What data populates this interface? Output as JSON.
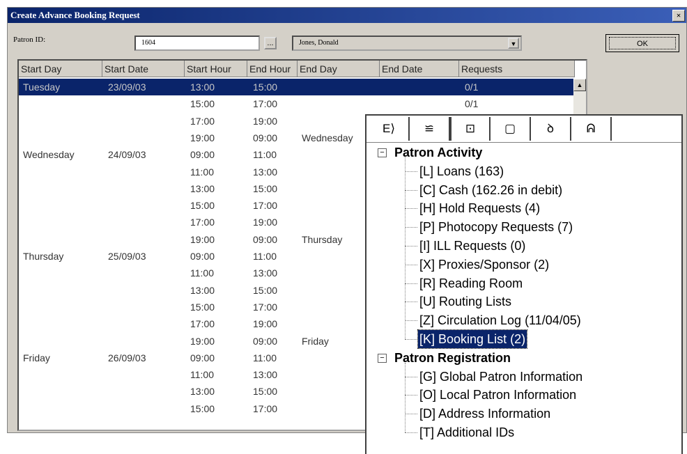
{
  "window": {
    "title": "Create Advance Booking Request",
    "close_label": "×"
  },
  "patron": {
    "id_label": "Patron ID:",
    "id_value": "1604",
    "lookup_label": "...",
    "name_value": "Jones, Donald",
    "dropdown_label": "▼"
  },
  "ok_label": "OK",
  "table": {
    "columns": [
      "Start Day",
      "Start Date",
      "Start Hour",
      "End Hour",
      "End Day",
      "End Date",
      "Requests"
    ],
    "rows": [
      [
        "Tuesday",
        "23/09/03",
        "13:00",
        "15:00",
        "",
        "",
        "0/1"
      ],
      [
        "",
        "",
        "15:00",
        "17:00",
        "",
        "",
        "0/1"
      ],
      [
        "",
        "",
        "17:00",
        "19:00",
        "",
        "",
        ""
      ],
      [
        "",
        "",
        "19:00",
        "09:00",
        "Wednesday",
        "",
        ""
      ],
      [
        "Wednesday",
        "24/09/03",
        "09:00",
        "11:00",
        "",
        "",
        ""
      ],
      [
        "",
        "",
        "11:00",
        "13:00",
        "",
        "",
        ""
      ],
      [
        "",
        "",
        "13:00",
        "15:00",
        "",
        "",
        ""
      ],
      [
        "",
        "",
        "15:00",
        "17:00",
        "",
        "",
        ""
      ],
      [
        "",
        "",
        "17:00",
        "19:00",
        "",
        "",
        ""
      ],
      [
        "",
        "",
        "19:00",
        "09:00",
        "Thursday",
        "",
        ""
      ],
      [
        "Thursday",
        "25/09/03",
        "09:00",
        "11:00",
        "",
        "",
        ""
      ],
      [
        "",
        "",
        "11:00",
        "13:00",
        "",
        "",
        ""
      ],
      [
        "",
        "",
        "13:00",
        "15:00",
        "",
        "",
        ""
      ],
      [
        "",
        "",
        "15:00",
        "17:00",
        "",
        "",
        ""
      ],
      [
        "",
        "",
        "17:00",
        "19:00",
        "",
        "",
        ""
      ],
      [
        "",
        "",
        "19:00",
        "09:00",
        "Friday",
        "",
        ""
      ],
      [
        "Friday",
        "26/09/03",
        "09:00",
        "11:00",
        "",
        "",
        ""
      ],
      [
        "",
        "",
        "11:00",
        "13:00",
        "",
        "",
        ""
      ],
      [
        "",
        "",
        "13:00",
        "15:00",
        "",
        "",
        ""
      ],
      [
        "",
        "",
        "15:00",
        "17:00",
        "",
        "",
        ""
      ]
    ],
    "selected_row": 0
  },
  "scroll_up_label": "▲",
  "panel": {
    "tabs": [
      {
        "icon": "exit-icon",
        "glyph": "E⟩"
      },
      {
        "icon": "patron-icon",
        "glyph": "≌"
      },
      {
        "icon": "activity-icon",
        "glyph": "⊡"
      },
      {
        "icon": "notebook-icon",
        "glyph": "▢"
      },
      {
        "icon": "hand-icon",
        "glyph": "ꝺ"
      },
      {
        "icon": "binoculars-icon",
        "glyph": "ᕱ"
      }
    ],
    "active_tab": 2,
    "groups": [
      {
        "label": "Patron Activity",
        "expander": "−",
        "items": [
          "[L] Loans (163)",
          "[C] Cash (162.26 in debit)",
          "[H] Hold Requests (4)",
          "[P] Photocopy Requests (7)",
          "[I] ILL Requests (0)",
          "[X] Proxies/Sponsor (2)",
          "[R] Reading Room",
          "[U] Routing Lists",
          "[Z] Circulation Log (11/04/05)",
          "[K] Booking List (2)"
        ],
        "selected_item": 9
      },
      {
        "label": "Patron Registration",
        "expander": "−",
        "items": [
          "[G] Global Patron Information",
          "[O] Local Patron Information",
          "[D] Address Information",
          "[T] Additional IDs"
        ]
      }
    ]
  }
}
